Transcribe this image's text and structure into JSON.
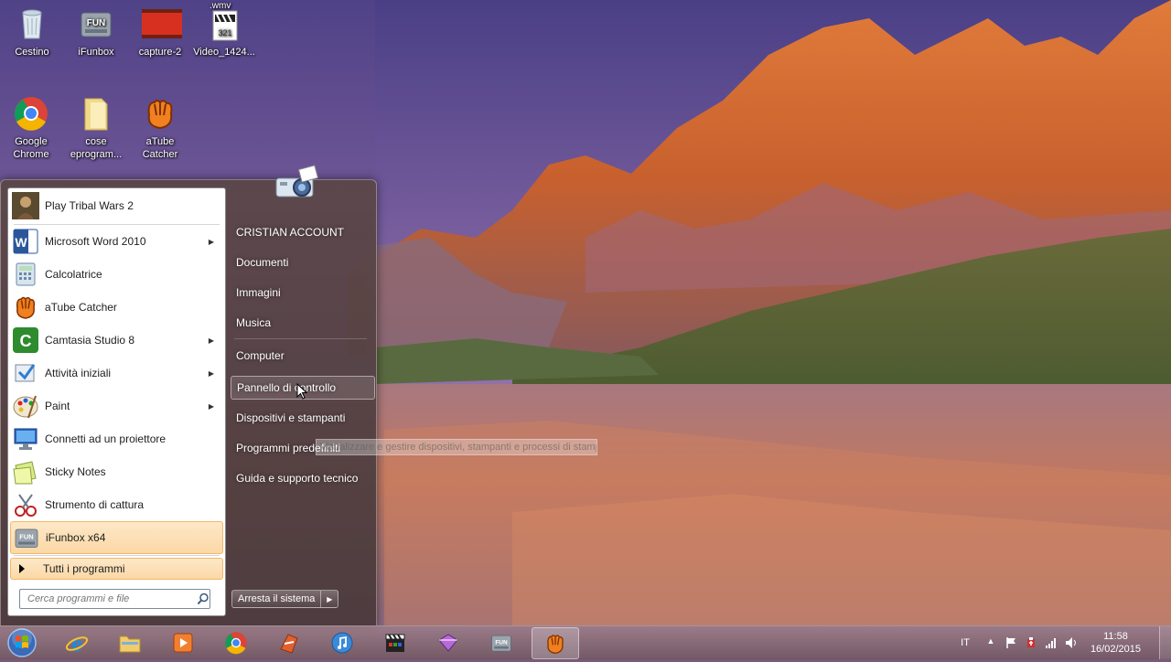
{
  "desktop": {
    "icons": [
      {
        "label": "Cestino",
        "icon": "recycle-bin-icon"
      },
      {
        "label": "iFunbox",
        "icon": "ifunbox-icon"
      },
      {
        "label": "capture-2",
        "icon": "video-file-icon"
      },
      {
        "label": "Video_1424...",
        "icon": "wmv-file-icon",
        "badge": ".wmv"
      },
      {
        "label": "Google\nChrome",
        "icon": "chrome-icon"
      },
      {
        "label": "cose\neprogram...",
        "icon": "folder-icon"
      },
      {
        "label": "aTube\nCatcher",
        "icon": "atube-catcher-icon"
      }
    ]
  },
  "start_menu": {
    "programs": [
      {
        "label": "Play Tribal Wars 2",
        "icon": "tribal-wars-icon",
        "submenu": false
      },
      {
        "label": "Microsoft Word 2010",
        "icon": "word-icon",
        "submenu": true
      },
      {
        "label": "Calcolatrice",
        "icon": "calculator-icon",
        "submenu": false
      },
      {
        "label": "aTube Catcher",
        "icon": "atube-catcher-icon",
        "submenu": false
      },
      {
        "label": "Camtasia Studio 8",
        "icon": "camtasia-icon",
        "submenu": true
      },
      {
        "label": "Attività iniziali",
        "icon": "getting-started-icon",
        "submenu": true
      },
      {
        "label": "Paint",
        "icon": "paint-icon",
        "submenu": true
      },
      {
        "label": "Connetti ad un proiettore",
        "icon": "projector-icon",
        "submenu": false
      },
      {
        "label": "Sticky Notes",
        "icon": "sticky-notes-icon",
        "submenu": false
      },
      {
        "label": "Strumento di cattura",
        "icon": "snipping-tool-icon",
        "submenu": false
      },
      {
        "label": "iFunbox x64",
        "icon": "ifunbox-icon",
        "submenu": false
      }
    ],
    "all_programs": "Tutti i programmi",
    "search_placeholder": "Cerca programmi e file",
    "right_items": [
      {
        "label": "CRISTIAN ACCOUNT"
      },
      {
        "label": "Documenti"
      },
      {
        "label": "Immagini"
      },
      {
        "label": "Musica"
      },
      {
        "label": "Computer"
      },
      {
        "label": "Pannello di controllo"
      },
      {
        "label": "Dispositivi e stampanti"
      },
      {
        "label": "Programmi predefiniti"
      },
      {
        "label": "Guida e supporto tecnico"
      }
    ],
    "shutdown_label": "Arresta il sistema",
    "tooltip": "Visualizzare e gestire dispositivi, stampanti e processi di stampa"
  },
  "taskbar": {
    "apps": [
      "internet-explorer-icon",
      "explorer-folder-icon",
      "media-player-icon",
      "chrome-icon",
      "app-icon",
      "itunes-icon",
      "clapper-icon",
      "vpn-icon",
      "ifunbox-icon",
      "atube-catcher-icon"
    ],
    "language": "IT",
    "time": "11:58",
    "date": "16/02/2015"
  },
  "colors": {
    "highlight": "#fbd8a6",
    "menu_dark": "#5a4646"
  }
}
